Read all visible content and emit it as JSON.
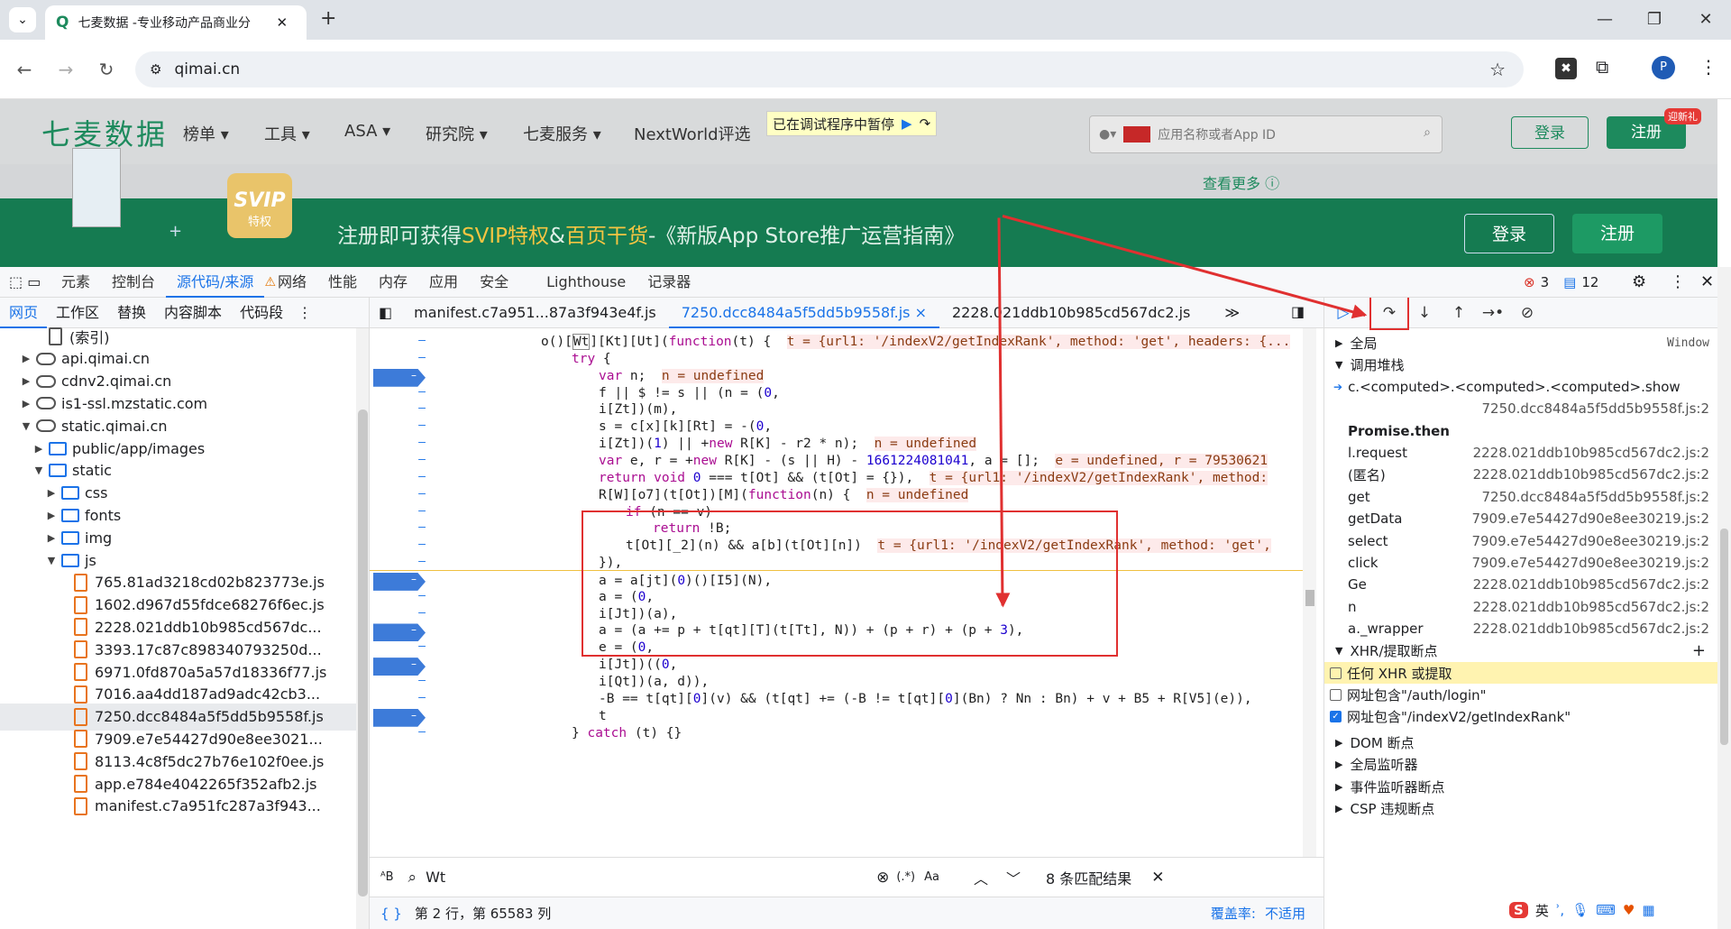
{
  "browser": {
    "tab_title": "七麦数据 -专业移动产品商业分",
    "new_tab": "+",
    "url": "qimai.cn",
    "profile_initial": "P",
    "window_controls": [
      "—",
      "❐",
      "✕"
    ]
  },
  "site": {
    "logo": "七麦数据",
    "nav": [
      "榜单 ▾",
      "工具 ▾",
      "ASA ▾",
      "研究院 ▾",
      "七麦服务 ▾",
      "NextWorld评选"
    ],
    "paused_badge": "已在调试程序中暂停",
    "search_placeholder": "应用名称或者App ID",
    "login": "登录",
    "register": "注册",
    "register_tag": "迎新礼",
    "see_more": "查看更多 ⓘ",
    "svip": "SVIP",
    "svip_sub": "特权",
    "banner_pre": "注册即可获得",
    "banner_hl1": "SVIP特权",
    "banner_mid": "&",
    "banner_hl2": "百页干货",
    "banner_post": "-《新版App Store推广运营指南》",
    "banner_login": "登录",
    "banner_register": "注册",
    "plus": "+"
  },
  "devtools": {
    "tabs": [
      "元素",
      "控制台",
      "源代码/来源",
      "网络",
      "性能",
      "内存",
      "应用",
      "安全",
      "Lighthouse",
      "记录器"
    ],
    "errors": "3",
    "messages": "12",
    "left_tabs": [
      "网页",
      "工作区",
      "替换",
      "内容脚本",
      "代码段"
    ],
    "tree": [
      {
        "label": "(索引)",
        "type": "file-plain",
        "indent": 2
      },
      {
        "label": "api.qimai.cn",
        "type": "cloud",
        "indent": 1,
        "arrow": "▶"
      },
      {
        "label": "cdnv2.qimai.cn",
        "type": "cloud",
        "indent": 1,
        "arrow": "▶"
      },
      {
        "label": "is1-ssl.mzstatic.com",
        "type": "cloud",
        "indent": 1,
        "arrow": "▶"
      },
      {
        "label": "static.qimai.cn",
        "type": "cloud",
        "indent": 1,
        "arrow": "▼"
      },
      {
        "label": "public/app/images",
        "type": "folder",
        "indent": 2,
        "arrow": "▶"
      },
      {
        "label": "static",
        "type": "folder",
        "indent": 2,
        "arrow": "▼"
      },
      {
        "label": "css",
        "type": "folder",
        "indent": 3,
        "arrow": "▶"
      },
      {
        "label": "fonts",
        "type": "folder",
        "indent": 3,
        "arrow": "▶"
      },
      {
        "label": "img",
        "type": "folder",
        "indent": 3,
        "arrow": "▶"
      },
      {
        "label": "js",
        "type": "folder",
        "indent": 3,
        "arrow": "▼"
      },
      {
        "label": "765.81ad3218cd02b823773e.js",
        "type": "file",
        "indent": 4
      },
      {
        "label": "1602.d967d55fdce68276f6ec.js",
        "type": "file",
        "indent": 4
      },
      {
        "label": "2228.021ddb10b985cd567dc...",
        "type": "file",
        "indent": 4
      },
      {
        "label": "3393.17c87c898340793250d...",
        "type": "file",
        "indent": 4
      },
      {
        "label": "6971.0fd870a5a57d18336f77.js",
        "type": "file",
        "indent": 4
      },
      {
        "label": "7016.aa4dd187ad9adc42cb3...",
        "type": "file",
        "indent": 4
      },
      {
        "label": "7250.dcc8484a5f5dd5b9558f.js",
        "type": "file",
        "indent": 4,
        "selected": true
      },
      {
        "label": "7909.e7e54427d90e8ee3021...",
        "type": "file",
        "indent": 4
      },
      {
        "label": "8113.4c8f5dc27b76e102f0ee.js",
        "type": "file",
        "indent": 4
      },
      {
        "label": "app.e784e4042265f352afb2.js",
        "type": "file",
        "indent": 4
      },
      {
        "label": "manifest.c7a951fc287a3f943...",
        "type": "file",
        "indent": 4
      }
    ],
    "editor_tabs": [
      "manifest.c7a951...87a3f943e4f.js",
      "7250.dcc8484a5f5dd5b9558f.js ×",
      "2228.021ddb10b985cd567dc2.js",
      "≫"
    ],
    "code": [
      {
        "html": "o()[<span style='border:1px solid #888'>Wt</span>][Kt][Ut](<span class='kw'>function</span>(t) {  <span class='inl'>t = {url1: '/indexV2/getIndexRank', method: 'get', headers: {...</span>",
        "indent": 190,
        "bp": false
      },
      {
        "html": "<span class='kw'>try</span> {",
        "indent": 224,
        "bp": false
      },
      {
        "html": "<span class='kw'>var</span> n;  <span class='inl'>n = undefined</span>",
        "indent": 254,
        "bp": true
      },
      {
        "html": "f || $ != s || (n = (<span class='num'>0</span>,",
        "indent": 254,
        "bp": false
      },
      {
        "html": "i[Zt])(m),",
        "indent": 254,
        "bp": false
      },
      {
        "html": "s = c[x][k][Rt] = -(<span class='num'>0</span>,",
        "indent": 254,
        "bp": false
      },
      {
        "html": "i[Zt])(<span class='num'>1</span>) || +<span class='kw'>new</span> R[K] - r2 * n);  <span class='inl'>n = undefined</span>",
        "indent": 254,
        "bp": false
      },
      {
        "html": "<span class='kw'>var</span> e, r = +<span class='kw'>new</span> R[K] - (s || H) - <span class='num'>1661224081041</span>, a = [];  <span class='inl'>e = undefined, r = 79530621</span>",
        "indent": 254,
        "bp": false
      },
      {
        "html": "<span class='kw'>return void</span> <span class='num'>0</span> === t[Ot] &amp;&amp; (t[Ot] = {}),  <span class='inl'>t = {url1: '/indexV2/getIndexRank', method:</span>",
        "indent": 254,
        "bp": false
      },
      {
        "html": "R[W][o7](t[Ot])[M](<span class='kw'>function</span>(n) {  <span class='inl'>n = undefined</span>",
        "indent": 254,
        "bp": false
      },
      {
        "html": "<span class='kw'>if</span> (n == v)",
        "indent": 284,
        "bp": false
      },
      {
        "html": "<span class='kw'>return</span> !B;",
        "indent": 314,
        "bp": false
      },
      {
        "html": "t[Ot][_2](n) &amp;&amp; a[b](t[Ot][n])  <span class='inl'>t = {url1: '/indexV2/getIndexRank', method: 'get',</span>",
        "indent": 284,
        "bp": false
      },
      {
        "html": "}),",
        "indent": 254,
        "bp": false
      },
      {
        "html": "a = a[jt](<span class='num'>0</span>)()[I5](N),",
        "indent": 254,
        "bp": true
      },
      {
        "html": "a = (<span class='num'>0</span>,",
        "indent": 254,
        "bp": false
      },
      {
        "html": "i[Jt])(a),",
        "indent": 254,
        "bp": false
      },
      {
        "html": "a = (a += p + t[qt][T](t[Tt], N)) + (p + r) + (p + <span class='num'>3</span>),",
        "indent": 254,
        "bp": true
      },
      {
        "html": "e = (<span class='num'>0</span>,",
        "indent": 254,
        "bp": false
      },
      {
        "html": "i[Jt])((<span class='num'>0</span>,",
        "indent": 254,
        "bp": true
      },
      {
        "html": "i[Qt])(a, d)),",
        "indent": 254,
        "bp": false
      },
      {
        "html": "-B == t[qt][<span class='num'>0</span>](v) &amp;&amp; (t[qt] += (-B != t[qt][<span class='num'>0</span>](Bn) ? Nn : Bn) + v + B5 + R[V5](e)),",
        "indent": 254,
        "bp": false
      },
      {
        "html": "t",
        "indent": 254,
        "bp": true
      },
      {
        "html": "} <span class='kw'>catch</span> (t) {}",
        "indent": 224,
        "bp": false
      }
    ],
    "search_value": "Wt",
    "search_matches": "8 条匹配结果",
    "search_regex": "(.*)",
    "search_case": "Aa",
    "status_position": "第 2 行，第 65583 列",
    "status_coverage_label": "覆盖率:",
    "status_coverage_value": "不适用",
    "right": {
      "scope_global": "全局",
      "scope_global_val": "Window",
      "call_stack_title": "调用堆栈",
      "call_stack": [
        {
          "name": "c.<computed>.<computed>.<computed>.show",
          "loc": "7250.dcc8484a5f5dd5b9558f.js:2",
          "current": true
        },
        {
          "name": "Promise.then",
          "loc": "",
          "bold": true
        },
        {
          "name": "l.request",
          "loc": "2228.021ddb10b985cd567dc2.js:2"
        },
        {
          "name": "(匿名)",
          "loc": "2228.021ddb10b985cd567dc2.js:2"
        },
        {
          "name": "get",
          "loc": "7250.dcc8484a5f5dd5b9558f.js:2"
        },
        {
          "name": "getData",
          "loc": "7909.e7e54427d90e8ee30219.js:2"
        },
        {
          "name": "select",
          "loc": "7909.e7e54427d90e8ee30219.js:2"
        },
        {
          "name": "click",
          "loc": "7909.e7e54427d90e8ee30219.js:2"
        },
        {
          "name": "Ge",
          "loc": "2228.021ddb10b985cd567dc2.js:2"
        },
        {
          "name": "n",
          "loc": "2228.021ddb10b985cd567dc2.js:2"
        },
        {
          "name": "a._wrapper",
          "loc": "2228.021ddb10b985cd567dc2.js:2"
        }
      ],
      "xhr_title": "XHR/提取断点",
      "xhr_items": [
        {
          "label": "任何 XHR 或提取",
          "checked": false,
          "highlight": true
        },
        {
          "label": "网址包含\"/auth/login\"",
          "checked": false
        },
        {
          "label": "网址包含\"/indexV2/getIndexRank\"",
          "checked": true
        }
      ],
      "sections": [
        "DOM 断点",
        "全局监听器",
        "事件监听器断点",
        "CSP 违规断点"
      ],
      "ime": "英"
    }
  }
}
